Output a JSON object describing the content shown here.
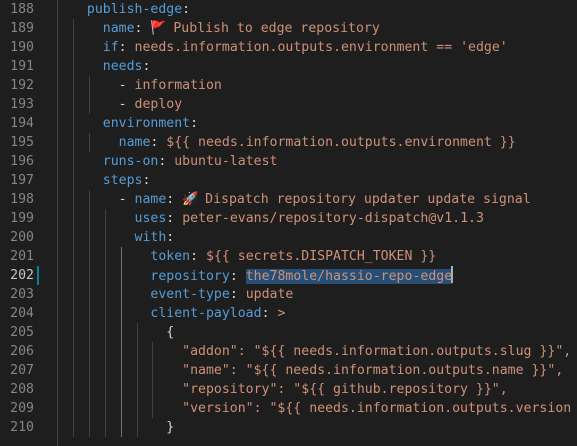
{
  "editor": {
    "active_line": "202",
    "lines": [
      {
        "num": "188",
        "indent": "  ",
        "key": "publish-edge",
        "sep": ":",
        "val": ""
      },
      {
        "num": "189",
        "indent": "    ",
        "key": "name",
        "sep": ": ",
        "icon": "🚩",
        "val": " Publish to edge repository"
      },
      {
        "num": "190",
        "indent": "    ",
        "key": "if",
        "sep": ": ",
        "val": "needs.information.outputs.environment == 'edge'"
      },
      {
        "num": "191",
        "indent": "    ",
        "key": "needs",
        "sep": ":",
        "val": ""
      },
      {
        "num": "192",
        "indent": "      ",
        "dash": "- ",
        "key": "",
        "sep": "",
        "val": "information"
      },
      {
        "num": "193",
        "indent": "      ",
        "dash": "- ",
        "key": "",
        "sep": "",
        "val": "deploy"
      },
      {
        "num": "194",
        "indent": "    ",
        "key": "environment",
        "sep": ":",
        "val": ""
      },
      {
        "num": "195",
        "indent": "      ",
        "key": "name",
        "sep": ": ",
        "val": "${{ needs.information.outputs.environment }}"
      },
      {
        "num": "196",
        "indent": "    ",
        "key": "runs-on",
        "sep": ": ",
        "val": "ubuntu-latest"
      },
      {
        "num": "197",
        "indent": "    ",
        "key": "steps",
        "sep": ":",
        "val": ""
      },
      {
        "num": "198",
        "indent": "      ",
        "dash": "- ",
        "key": "name",
        "sep": ": ",
        "icon": "🚀",
        "val": " Dispatch repository updater update signal"
      },
      {
        "num": "199",
        "indent": "        ",
        "key": "uses",
        "sep": ": ",
        "val": "peter-evans/repository-dispatch@v1.1.3"
      },
      {
        "num": "200",
        "indent": "        ",
        "key": "with",
        "sep": ":",
        "val": ""
      },
      {
        "num": "201",
        "indent": "          ",
        "key": "token",
        "sep": ": ",
        "val": "${{ secrets.DISPATCH_TOKEN }}"
      },
      {
        "num": "202",
        "indent": "          ",
        "key": "repository",
        "sep": ": ",
        "val": "the78mole/hassio-repo-edge",
        "selected": true
      },
      {
        "num": "203",
        "indent": "          ",
        "key": "event-type",
        "sep": ": ",
        "val": "update"
      },
      {
        "num": "204",
        "indent": "          ",
        "key": "client-payload",
        "sep": ": ",
        "val": ">"
      },
      {
        "num": "205",
        "indent": "            ",
        "key": "",
        "sep": "",
        "val": "{",
        "punct": true
      },
      {
        "num": "206",
        "indent": "              ",
        "key": "",
        "sep": "",
        "val": "\"addon\": \"${{ needs.information.outputs.slug }}\","
      },
      {
        "num": "207",
        "indent": "              ",
        "key": "",
        "sep": "",
        "val": "\"name\": \"${{ needs.information.outputs.name }}\","
      },
      {
        "num": "208",
        "indent": "              ",
        "key": "",
        "sep": "",
        "val": "\"repository\": \"${{ github.repository }}\","
      },
      {
        "num": "209",
        "indent": "              ",
        "key": "",
        "sep": "",
        "val": "\"version\": \"${{ needs.information.outputs.version }}\""
      },
      {
        "num": "210",
        "indent": "            ",
        "key": "",
        "sep": "",
        "val": "}",
        "punct": true
      }
    ]
  },
  "colors": {
    "background": "#1e1e1e",
    "key": "#569cd6",
    "string": "#ce9178",
    "line_number": "#858585",
    "selection": "#264f78"
  }
}
